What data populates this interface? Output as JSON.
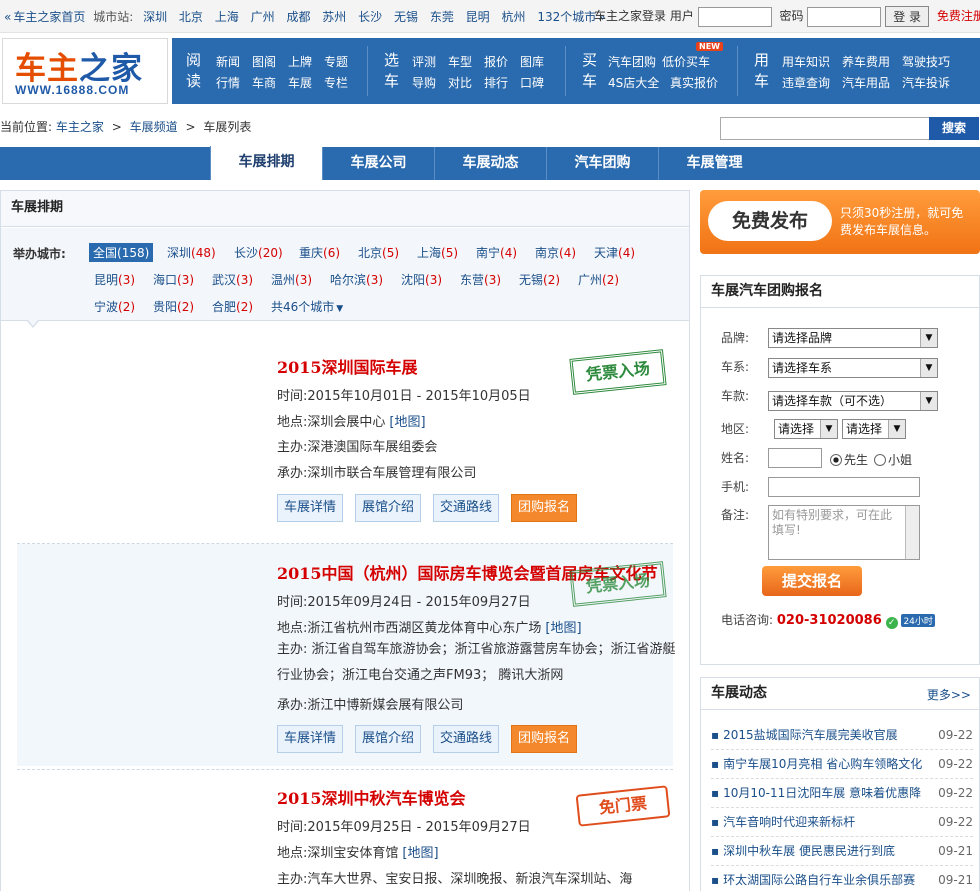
{
  "topbar": {
    "home": "车主之家首页",
    "sites_label": "城市站:",
    "cities": [
      "深圳",
      "北京",
      "上海",
      "广州",
      "成都",
      "苏州",
      "长沙",
      "无锡",
      "东莞",
      "昆明",
      "杭州"
    ],
    "more_cities": "132个城市",
    "login_label": "车主之家登录",
    "user_label": "用户",
    "pwd_label": "密码",
    "login_btn": "登 录",
    "register": "免费注册"
  },
  "logo": {
    "name_a": "车主",
    "name_b": "之家",
    "url": "WWW.16888.COM"
  },
  "nav": [
    {
      "cap": "阅读",
      "items": [
        "新闻",
        "行情",
        "图阁",
        "车商",
        "上牌",
        "车展",
        "专题",
        "专栏"
      ]
    },
    {
      "cap": "选车",
      "items": [
        "评测",
        "导购",
        "车型",
        "对比",
        "报价",
        "排行",
        "图库",
        "口碑"
      ]
    },
    {
      "cap": "买车",
      "items": [
        "汽车团购",
        "4S店大全",
        "低价买车",
        "真实报价"
      ],
      "badge": "NEW"
    },
    {
      "cap": "用车",
      "items": [
        "用车知识",
        "违章查询",
        "养车费用",
        "汽车用品",
        "驾驶技巧",
        "汽车投诉"
      ]
    }
  ],
  "breadcrumb": {
    "prefix": "当前位置:",
    "items": [
      "车主之家",
      "车展频道",
      "车展列表"
    ],
    "sep": ">"
  },
  "search": {
    "button": "搜索"
  },
  "channels": [
    {
      "label": "车展排期",
      "active": true
    },
    {
      "label": "车展公司"
    },
    {
      "label": "车展动态"
    },
    {
      "label": "汽车团购"
    },
    {
      "label": "车展管理"
    }
  ],
  "left": {
    "title": "车展排期",
    "city_label": "举办城市:",
    "cities": [
      {
        "name": "全国",
        "count": "(158)",
        "active": true
      },
      {
        "name": "深圳",
        "count": "(48)"
      },
      {
        "name": "长沙",
        "count": "(20)"
      },
      {
        "name": "重庆",
        "count": "(6)"
      },
      {
        "name": "北京",
        "count": "(5)"
      },
      {
        "name": "上海",
        "count": "(5)"
      },
      {
        "name": "南宁",
        "count": "(4)"
      },
      {
        "name": "南京",
        "count": "(4)"
      },
      {
        "name": "天津",
        "count": "(4)"
      },
      {
        "name": "昆明",
        "count": "(3)"
      },
      {
        "name": "海口",
        "count": "(3)"
      },
      {
        "name": "武汉",
        "count": "(3)"
      },
      {
        "name": "温州",
        "count": "(3)"
      },
      {
        "name": "哈尔滨",
        "count": "(3)"
      },
      {
        "name": "沈阳",
        "count": "(3)"
      },
      {
        "name": "东营",
        "count": "(3)"
      },
      {
        "name": "无锡",
        "count": "(2)"
      },
      {
        "name": "广州",
        "count": "(2)"
      },
      {
        "name": "宁波",
        "count": "(2)"
      },
      {
        "name": "贵阳",
        "count": "(2)"
      },
      {
        "name": "合肥",
        "count": "(2)"
      },
      {
        "name": "共46个城市",
        "count": ""
      }
    ]
  },
  "expos": [
    {
      "title": "2015深圳国际车展",
      "time": "时间:2015年10月01日 - 2015年10月05日",
      "place": "地点:深圳会展中心",
      "map": "[地图]",
      "host": "主办:深港澳国际车展组委会",
      "organizer": "承办:深圳市联合车展管理有限公司",
      "stamp": "凭票入场",
      "buttons": [
        "车展详情",
        "展馆介绍",
        "交通路线",
        "团购报名"
      ]
    },
    {
      "title": "2015中国（杭州）国际房车博览会暨首届房车文化节",
      "time": "时间:2015年09月24日 - 2015年09月27日",
      "place": "地点:浙江省杭州市西湖区黄龙体育中心东广场",
      "map": "[地图]",
      "host": "主办: 浙江省自驾车旅游协会；浙江省旅游露营房车协会；浙江省游艇行业协会；浙江电台交通之声FM93； 腾讯大浙网",
      "organizer": "承办:浙江中博新媒会展有限公司",
      "stamp": "凭票入场",
      "buttons": [
        "车展详情",
        "展馆介绍",
        "交通路线",
        "团购报名"
      ]
    },
    {
      "title": "2015深圳中秋汽车博览会",
      "time": "时间:2015年09月25日 - 2015年09月27日",
      "place": "地点:深圳宝安体育馆",
      "map": "[地图]",
      "host": "主办:汽车大世界、宝安日报、深圳晚报、新浪汽车深圳站、海",
      "stamp": "免门票"
    }
  ],
  "publish": {
    "button": "免费发布",
    "text": "只须30秒注册，就可免费发布车展信息。"
  },
  "register_form": {
    "title": "车展汽车团购报名",
    "brand_label": "品牌:",
    "brand_value": "请选择品牌",
    "series_label": "车系:",
    "series_value": "请选择车系",
    "model_label": "车款:",
    "model_value": "请选择车款（可不选）",
    "region_label": "地区:",
    "region_a": "请选择",
    "region_b": "请选择",
    "name_label": "姓名:",
    "mr": "先生",
    "ms": "小姐",
    "phone_label": "手机:",
    "note_label": "备注:",
    "note_placeholder": "如有特别要求，可在此填写!",
    "submit": "提交报名",
    "tel_label": "电话咨询:",
    "tel": "020-31020086",
    "hours": "24小时"
  },
  "news": {
    "title": "车展动态",
    "more": "更多>>",
    "items": [
      {
        "text": "2015盐城国际汽车展完美收官展",
        "date": "09-22"
      },
      {
        "text": "南宁车展10月亮相 省心购车领略文化",
        "date": "09-22"
      },
      {
        "text": "10月10-11日沈阳车展 意味着优惠降",
        "date": "09-22"
      },
      {
        "text": "汽车音响时代迎来新标杆",
        "date": "09-22"
      },
      {
        "text": "深圳中秋车展 便民惠民进行到底",
        "date": "09-21"
      },
      {
        "text": "环太湖国际公路自行车业余俱乐部赛",
        "date": "09-21"
      }
    ]
  }
}
